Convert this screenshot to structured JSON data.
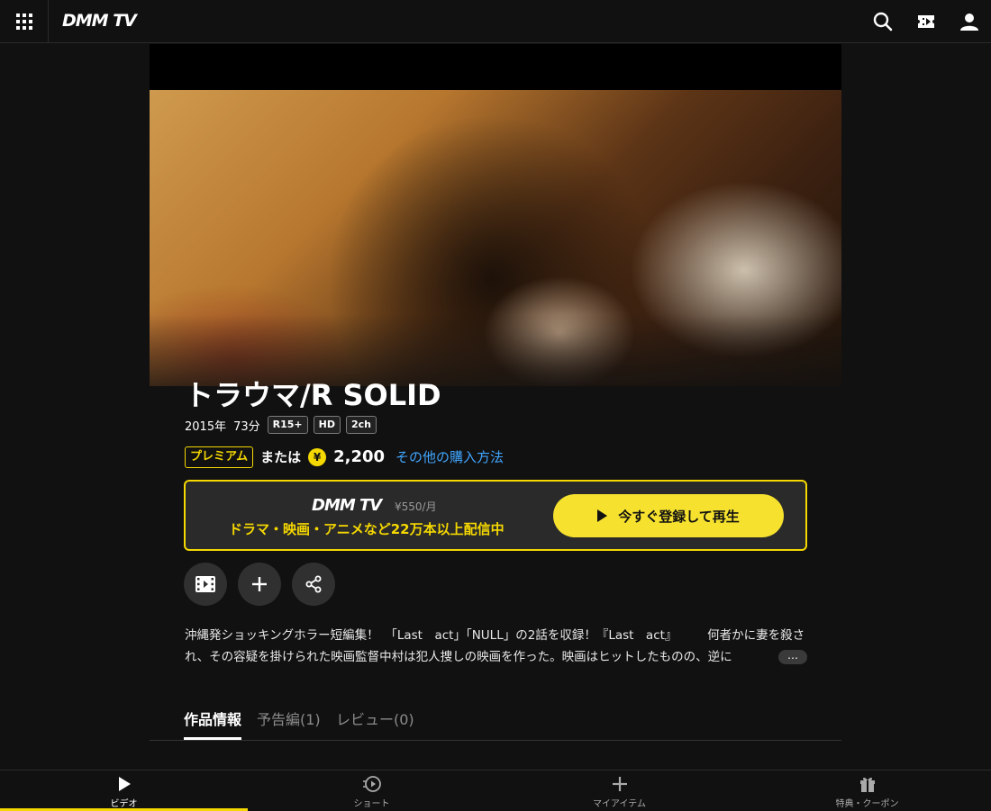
{
  "header": {
    "logo": "DMM TV",
    "icons": [
      "grid-icon",
      "search-icon",
      "ticket-icon",
      "user-icon"
    ]
  },
  "title": "トラウマ/R SOLID",
  "meta": {
    "year": "2015年",
    "duration": "73分",
    "badges": [
      "R15+",
      "HD",
      "2ch"
    ]
  },
  "purchase": {
    "premium_label": "プレミアム",
    "or_label": "または",
    "yen_symbol": "¥",
    "price": "2,200",
    "other_methods_link": "その他の購入方法"
  },
  "promo": {
    "logo": "DMM TV",
    "monthly_price": "¥550/月",
    "subtitle": "ドラマ・映画・アニメなど22万本以上配信中",
    "cta_label": "今すぐ登録して再生"
  },
  "actions": [
    "film-icon",
    "plus-icon",
    "share-icon"
  ],
  "description": "沖縄発ショッキングホラー短編集！　「Last　act」「NULL」の2話を収録！『Last　act』　　　何者かに妻を殺され、その容疑を掛けられた映画監督中村は犯人捜しの映画を作った。映画はヒットしたものの、逆に",
  "more_label": "…",
  "tabs": [
    {
      "label": "作品情報",
      "active": true
    },
    {
      "label": "予告編(1)",
      "active": false
    },
    {
      "label": "レビュー(0)",
      "active": false
    }
  ],
  "bottom_nav": [
    {
      "label": "ビデオ",
      "icon": "play-icon",
      "active": true
    },
    {
      "label": "ショート",
      "icon": "short-icon",
      "active": false
    },
    {
      "label": "マイアイテム",
      "icon": "plus-icon",
      "active": false
    },
    {
      "label": "特典・クーポン",
      "icon": "gift-icon",
      "active": false
    }
  ],
  "colors": {
    "accent": "#f5d800",
    "link": "#41a6ff",
    "background": "#111111"
  }
}
